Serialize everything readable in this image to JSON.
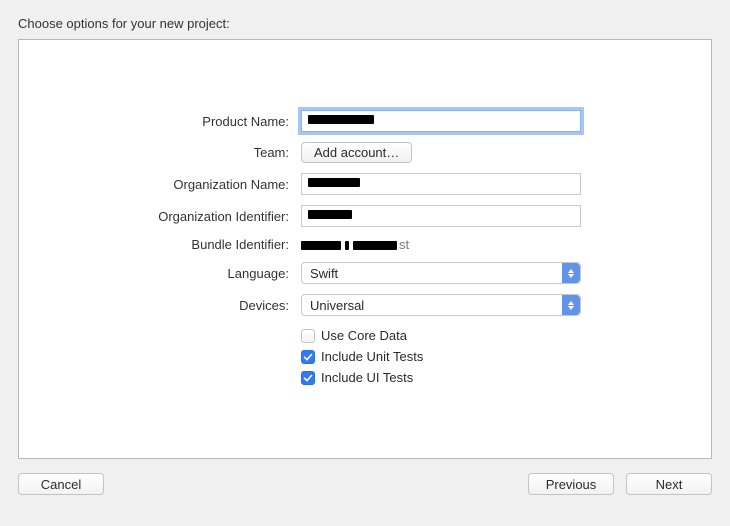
{
  "title": "Choose options for your new project:",
  "form": {
    "productName": {
      "label": "Product Name:",
      "value": ""
    },
    "team": {
      "label": "Team:",
      "buttonLabel": "Add account…"
    },
    "orgName": {
      "label": "Organization Name:",
      "value": ""
    },
    "orgId": {
      "label": "Organization Identifier:",
      "value": ""
    },
    "bundleId": {
      "label": "Bundle Identifier:",
      "value": "",
      "suffix": "st"
    },
    "language": {
      "label": "Language:",
      "selected": "Swift"
    },
    "devices": {
      "label": "Devices:",
      "selected": "Universal"
    },
    "checks": {
      "coreData": {
        "label": "Use Core Data",
        "checked": false
      },
      "unitTests": {
        "label": "Include Unit Tests",
        "checked": true
      },
      "uiTests": {
        "label": "Include UI Tests",
        "checked": true
      }
    }
  },
  "buttons": {
    "cancel": "Cancel",
    "previous": "Previous",
    "next": "Next"
  }
}
